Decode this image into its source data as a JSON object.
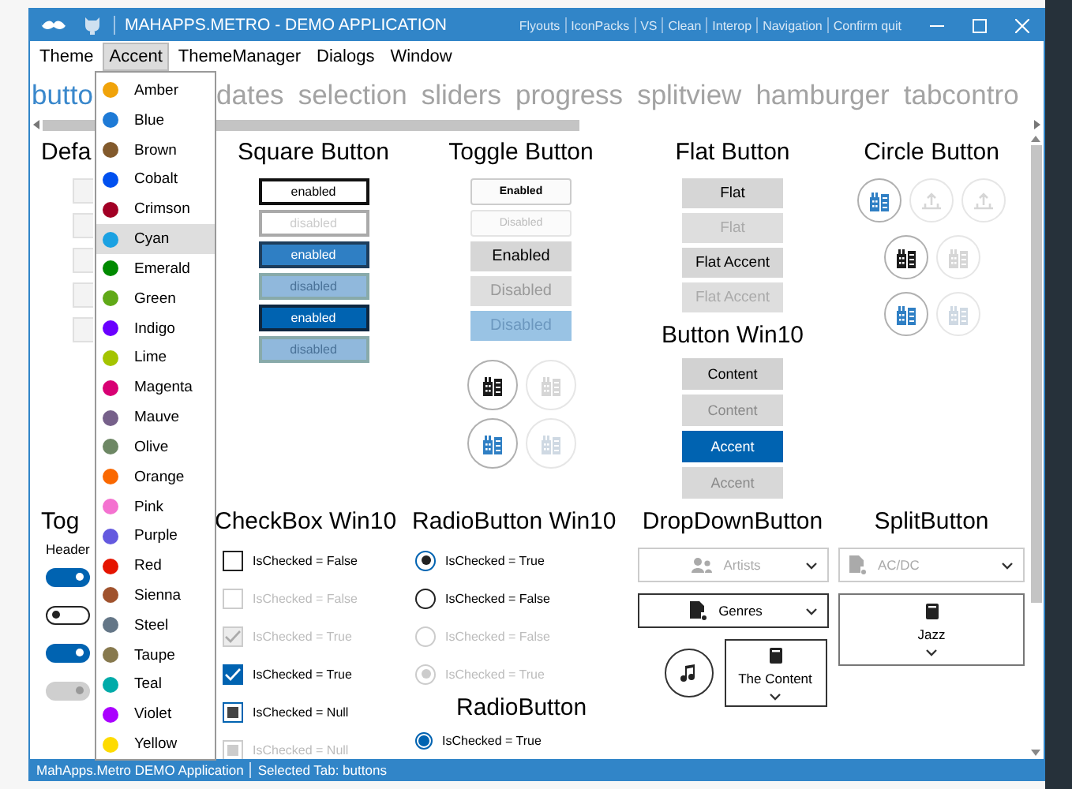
{
  "window": {
    "title": "MAHAPPS.METRO - DEMO APPLICATION",
    "commands": [
      "Flyouts",
      "IconPacks",
      "VS",
      "Clean",
      "Interop",
      "Navigation",
      "Confirm quit"
    ]
  },
  "menu": [
    {
      "label": "Theme",
      "selected": false
    },
    {
      "label": "Accent",
      "selected": true
    },
    {
      "label": "ThemeManager",
      "selected": false
    },
    {
      "label": "Dialogs",
      "selected": false
    },
    {
      "label": "Window",
      "selected": false
    }
  ],
  "accent_menu": [
    {
      "label": "Amber",
      "color": "#f0a30a",
      "selected": false
    },
    {
      "label": "Blue",
      "color": "#1e7ad6",
      "selected": false
    },
    {
      "label": "Brown",
      "color": "#825a2c",
      "selected": false
    },
    {
      "label": "Cobalt",
      "color": "#0050ef",
      "selected": false
    },
    {
      "label": "Crimson",
      "color": "#a20025",
      "selected": false
    },
    {
      "label": "Cyan",
      "color": "#1ba1e2",
      "selected": true
    },
    {
      "label": "Emerald",
      "color": "#008a00",
      "selected": false
    },
    {
      "label": "Green",
      "color": "#60a917",
      "selected": false
    },
    {
      "label": "Indigo",
      "color": "#6a00ff",
      "selected": false
    },
    {
      "label": "Lime",
      "color": "#a4c400",
      "selected": false
    },
    {
      "label": "Magenta",
      "color": "#d80073",
      "selected": false
    },
    {
      "label": "Mauve",
      "color": "#76608a",
      "selected": false
    },
    {
      "label": "Olive",
      "color": "#6d8764",
      "selected": false
    },
    {
      "label": "Orange",
      "color": "#fa6800",
      "selected": false
    },
    {
      "label": "Pink",
      "color": "#f472d0",
      "selected": false
    },
    {
      "label": "Purple",
      "color": "#6459df",
      "selected": false
    },
    {
      "label": "Red",
      "color": "#e51400",
      "selected": false
    },
    {
      "label": "Sienna",
      "color": "#a0522d",
      "selected": false
    },
    {
      "label": "Steel",
      "color": "#647687",
      "selected": false
    },
    {
      "label": "Taupe",
      "color": "#87794e",
      "selected": false
    },
    {
      "label": "Teal",
      "color": "#00aba9",
      "selected": false
    },
    {
      "label": "Violet",
      "color": "#aa00ff",
      "selected": false
    },
    {
      "label": "Yellow",
      "color": "#fedb00",
      "selected": false
    }
  ],
  "tabs": [
    {
      "label": "butto",
      "selected": true
    },
    {
      "label": "dates",
      "selected": false
    },
    {
      "label": "selection",
      "selected": false
    },
    {
      "label": "sliders",
      "selected": false
    },
    {
      "label": "progress",
      "selected": false
    },
    {
      "label": "splitview",
      "selected": false
    },
    {
      "label": "hamburger",
      "selected": false
    },
    {
      "label": "tabcontro",
      "selected": false
    }
  ],
  "default_buttons": {
    "title": "Defa",
    "buttons": [
      {
        "disabled": false
      },
      {
        "disabled": false
      },
      {
        "disabled": false
      },
      {
        "disabled": false
      },
      {
        "disabled": false
      }
    ]
  },
  "square_buttons": {
    "title": "Square Button",
    "buttons": [
      {
        "label": "enabled",
        "kind": "outline",
        "disabled": false
      },
      {
        "label": "disabled",
        "kind": "outline",
        "disabled": true
      },
      {
        "label": "enabled",
        "kind": "accent",
        "disabled": false
      },
      {
        "label": "disabled",
        "kind": "accent",
        "disabled": true
      },
      {
        "label": "enabled",
        "kind": "dark",
        "disabled": false
      },
      {
        "label": "disabled",
        "kind": "dark",
        "disabled": true
      }
    ]
  },
  "toggle_buttons": {
    "title": "Toggle Button",
    "buttons": [
      {
        "label": "Enabled",
        "kind": "small",
        "disabled": false
      },
      {
        "label": "Disabled",
        "kind": "small",
        "disabled": true
      },
      {
        "label": "Enabled",
        "kind": "gray",
        "disabled": false
      },
      {
        "label": "Disabled",
        "kind": "gray",
        "disabled": true
      },
      {
        "label": "Disabled",
        "kind": "accent",
        "disabled": true
      }
    ],
    "circles": [
      [
        {
          "kind": "default",
          "disabled": false
        },
        {
          "kind": "default",
          "disabled": true
        }
      ],
      [
        {
          "kind": "accent",
          "disabled": false
        },
        {
          "kind": "accent",
          "disabled": true
        }
      ]
    ]
  },
  "flat_buttons": {
    "title": "Flat Button",
    "buttons": [
      {
        "label": "Flat",
        "disabled": false
      },
      {
        "label": "Flat",
        "disabled": true
      },
      {
        "label": "Flat Accent",
        "disabled": false
      },
      {
        "label": "Flat Accent",
        "disabled": true
      }
    ]
  },
  "win10_buttons": {
    "title": "Button Win10",
    "buttons": [
      {
        "label": "Content",
        "kind": "default",
        "disabled": false
      },
      {
        "label": "Content",
        "kind": "default",
        "disabled": true
      },
      {
        "label": "Accent",
        "kind": "accent",
        "disabled": false
      },
      {
        "label": "Accent",
        "kind": "accent",
        "disabled": true
      }
    ]
  },
  "circle_buttons": {
    "title": "Circle Button",
    "rows": [
      [
        {
          "kind": "accent",
          "disabled": false
        },
        {
          "kind": "default",
          "disabled": true
        },
        {
          "kind": "default",
          "disabled": true
        }
      ],
      [
        {
          "kind": "default",
          "disabled": false
        },
        {
          "kind": "default",
          "disabled": true
        }
      ],
      [
        {
          "kind": "accent",
          "disabled": false
        },
        {
          "kind": "accent",
          "disabled": true
        }
      ]
    ]
  },
  "toggle_switches": {
    "title": "Tog",
    "header": "Header",
    "switches": [
      {
        "on": true,
        "disabled": false
      },
      {
        "on": false,
        "disabled": false
      },
      {
        "on": true,
        "disabled": false
      },
      {
        "on": true,
        "disabled": true
      }
    ]
  },
  "checkboxes": {
    "title": "CheckBox Win10",
    "items": [
      {
        "label": "IsChecked = False",
        "checked": false,
        "indeterminate": false,
        "disabled": false
      },
      {
        "label": "IsChecked = False",
        "checked": false,
        "indeterminate": false,
        "disabled": true
      },
      {
        "label": "IsChecked = True",
        "checked": true,
        "indeterminate": false,
        "disabled": true
      },
      {
        "label": "IsChecked = True",
        "checked": true,
        "indeterminate": false,
        "disabled": false
      },
      {
        "label": "IsChecked = Null",
        "checked": false,
        "indeterminate": true,
        "disabled": false
      },
      {
        "label": "IsChecked = Null",
        "checked": false,
        "indeterminate": true,
        "disabled": true
      }
    ]
  },
  "radios_win10": {
    "title": "RadioButton Win10",
    "items": [
      {
        "label": "IsChecked = True",
        "checked": true,
        "disabled": false
      },
      {
        "label": "IsChecked = False",
        "checked": false,
        "disabled": false
      },
      {
        "label": "IsChecked = False",
        "checked": false,
        "disabled": true
      },
      {
        "label": "IsChecked = True",
        "checked": true,
        "disabled": true
      }
    ]
  },
  "radios": {
    "title": "RadioButton",
    "items": [
      {
        "label": "IsChecked = True",
        "checked": true,
        "disabled": false
      }
    ]
  },
  "dropdown_buttons": {
    "title": "DropDownButton",
    "buttons": [
      {
        "label": "Artists",
        "disabled": true
      },
      {
        "label": "Genres",
        "disabled": false
      }
    ],
    "content": "The Content"
  },
  "split_buttons": {
    "title": "SplitButton",
    "buttons": [
      {
        "label": "AC/DC",
        "disabled": true
      }
    ],
    "content": "Jazz"
  },
  "status_bar": [
    "MahApps.Metro DEMO Application",
    "Selected Tab: buttons"
  ]
}
